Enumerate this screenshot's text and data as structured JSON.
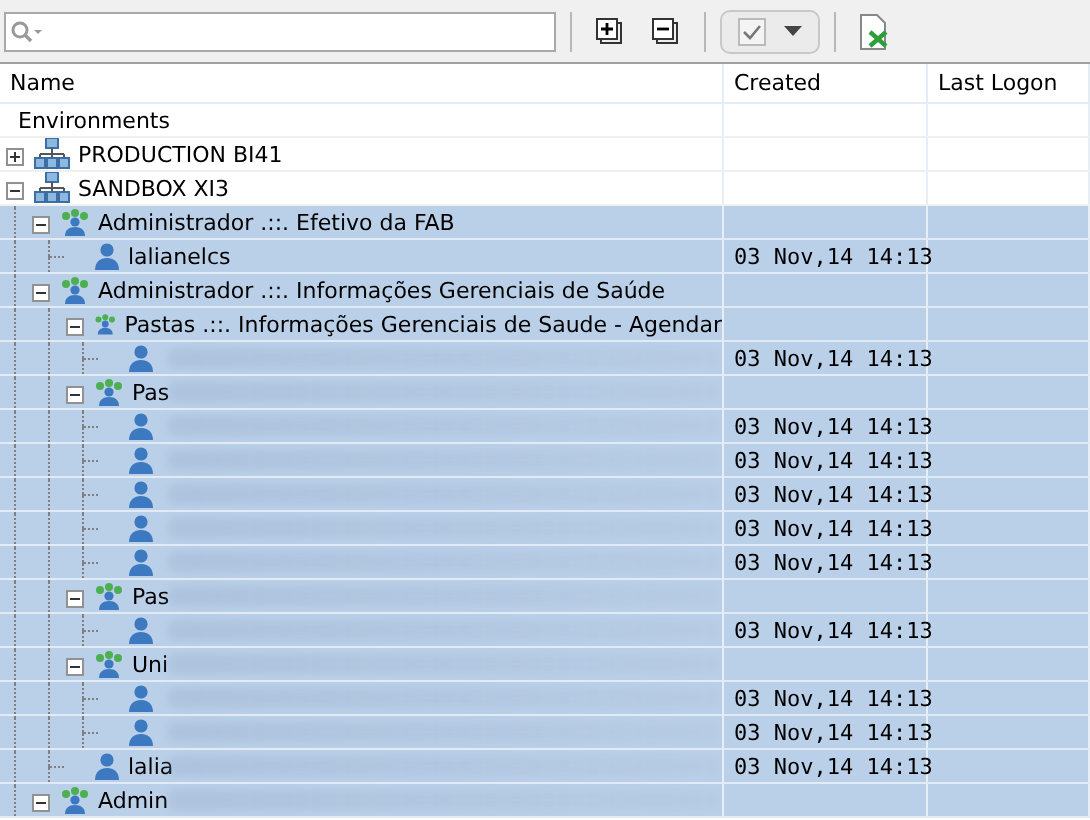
{
  "table": {
    "columns": [
      "Name",
      "Created",
      "Last Logon"
    ],
    "tree": [
      {
        "kind": "label",
        "name": "Environments",
        "selected": false
      },
      {
        "kind": "server",
        "name": "PRODUCTION BI41",
        "selected": false,
        "expanded": false
      },
      {
        "kind": "server",
        "name": "SANDBOX XI3",
        "selected": false,
        "expanded": true,
        "children": [
          {
            "kind": "group",
            "name": "Administrador .::. Efetivo da FAB",
            "selected": true,
            "expanded": true,
            "children": [
              {
                "kind": "user",
                "name": "lalianelcs",
                "created": "03 Nov,14 14:13",
                "selected": true
              }
            ]
          },
          {
            "kind": "group",
            "name": "Administrador .::. Informações Gerenciais de Saúde",
            "selected": true,
            "expanded": true,
            "children": [
              {
                "kind": "group",
                "name": "Pastas .::. Informações Gerenciais de Saude - Agendar",
                "selected": true,
                "expanded": true,
                "children": [
                  {
                    "kind": "user",
                    "redacted": true,
                    "created": "03 Nov,14 14:13",
                    "selected": true
                  }
                ]
              },
              {
                "kind": "group",
                "name": "Pas",
                "redacted": true,
                "selected": true,
                "expanded": true,
                "children": [
                  {
                    "kind": "user",
                    "redacted": true,
                    "created": "03 Nov,14 14:13",
                    "selected": true
                  },
                  {
                    "kind": "user",
                    "redacted": true,
                    "created": "03 Nov,14 14:13",
                    "selected": true
                  },
                  {
                    "kind": "user",
                    "redacted": true,
                    "created": "03 Nov,14 14:13",
                    "selected": true
                  },
                  {
                    "kind": "user",
                    "redacted": true,
                    "created": "03 Nov,14 14:13",
                    "selected": true
                  },
                  {
                    "kind": "user",
                    "redacted": true,
                    "created": "03 Nov,14 14:13",
                    "selected": true
                  }
                ]
              },
              {
                "kind": "group",
                "name": "Pas",
                "redacted": true,
                "selected": true,
                "expanded": true,
                "children": [
                  {
                    "kind": "user",
                    "redacted": true,
                    "created": "03 Nov,14 14:13",
                    "selected": true
                  }
                ]
              },
              {
                "kind": "group",
                "name": "Uni",
                "redacted": true,
                "selected": true,
                "expanded": true,
                "children": [
                  {
                    "kind": "user",
                    "redacted": true,
                    "created": "03 Nov,14 14:13",
                    "selected": true
                  },
                  {
                    "kind": "user",
                    "redacted": true,
                    "created": "03 Nov,14 14:13",
                    "selected": true
                  }
                ]
              },
              {
                "kind": "user",
                "name": "lalia",
                "redacted": true,
                "created": "03 Nov,14 14:13",
                "selected": true
              }
            ]
          },
          {
            "kind": "group",
            "name": "Admin",
            "redacted": true,
            "selected": true,
            "expanded": true
          }
        ]
      }
    ]
  }
}
